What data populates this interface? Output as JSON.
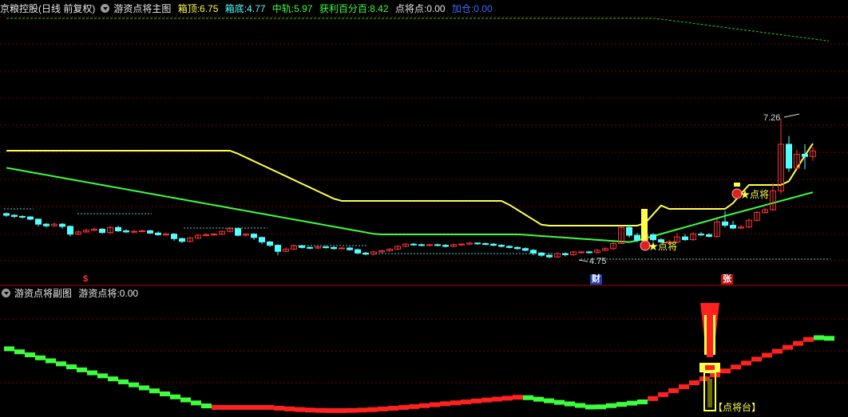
{
  "main_header": {
    "stock": "京粮控股(日线 前复权)",
    "indicator": "游资点将主图",
    "box_top_label": "箱顶:",
    "box_top_value": "6.75",
    "box_bottom_label": "箱底:",
    "box_bottom_value": "4.77",
    "mid_label": "中轨:",
    "mid_value": "5.97",
    "profit_label": "获利百分百:",
    "profit_value": "8.42",
    "point_label": "点将点:",
    "point_value": "0.00",
    "add_label": "加仓:",
    "add_value": "0.00"
  },
  "sub_header": {
    "indicator": "游资点将副图",
    "label": "游资点将:",
    "value": "0.00"
  },
  "markers": {
    "s": "$",
    "cai": "财",
    "zhang": "张"
  },
  "colors": {
    "up": "#ff3232",
    "down": "#54ffff",
    "yellow": "#ffff4a",
    "green": "#22cc22",
    "bright_green": "#3cff3c",
    "red": "#ff2020",
    "grid": "#7a0000",
    "white": "#dddddd",
    "blue": "#3c6cff"
  },
  "chart_data": {
    "type": "candlestick",
    "high_annotation": "7.26",
    "low_annotation": "4.75",
    "point_label_1": "★点将",
    "point_label_2": "★点将",
    "sub_label": "【点将台】",
    "candles": [
      [
        5.55,
        5.52,
        5.57,
        5.49
      ],
      [
        5.52,
        5.5,
        5.54,
        5.47
      ],
      [
        5.5,
        5.49,
        5.52,
        5.46
      ],
      [
        5.49,
        5.45,
        5.51,
        5.43
      ],
      [
        5.45,
        5.36,
        5.46,
        5.32
      ],
      [
        5.36,
        5.33,
        5.38,
        5.3
      ],
      [
        5.33,
        5.36,
        5.39,
        5.31
      ],
      [
        5.36,
        5.32,
        5.38,
        5.28
      ],
      [
        5.32,
        5.18,
        5.34,
        5.14
      ],
      [
        5.18,
        5.22,
        5.25,
        5.16
      ],
      [
        5.22,
        5.25,
        5.28,
        5.2
      ],
      [
        5.25,
        5.27,
        5.3,
        5.23
      ],
      [
        5.27,
        5.21,
        5.29,
        5.19
      ],
      [
        5.21,
        5.3,
        5.33,
        5.18
      ],
      [
        5.3,
        5.24,
        5.33,
        5.22
      ],
      [
        5.24,
        5.22,
        5.27,
        5.2
      ],
      [
        5.22,
        5.23,
        5.26,
        5.2
      ],
      [
        5.23,
        5.24,
        5.26,
        5.21
      ],
      [
        5.24,
        5.2,
        5.26,
        5.18
      ],
      [
        5.2,
        5.17,
        5.23,
        5.15
      ],
      [
        5.17,
        5.18,
        5.21,
        5.15
      ],
      [
        5.18,
        5.1,
        5.2,
        5.06
      ],
      [
        5.1,
        5.05,
        5.12,
        5.02
      ],
      [
        5.05,
        5.11,
        5.13,
        5.03
      ],
      [
        5.11,
        5.16,
        5.18,
        5.09
      ],
      [
        5.16,
        5.17,
        5.2,
        5.14
      ],
      [
        5.17,
        5.18,
        5.2,
        5.15
      ],
      [
        5.18,
        5.23,
        5.25,
        5.16
      ],
      [
        5.23,
        5.28,
        5.31,
        5.21
      ],
      [
        5.28,
        5.16,
        5.3,
        5.14
      ],
      [
        5.16,
        5.18,
        5.2,
        5.14
      ],
      [
        5.18,
        5.12,
        5.2,
        5.08
      ],
      [
        5.12,
        5.04,
        5.14,
        5.0
      ],
      [
        5.04,
        4.98,
        5.06,
        4.95
      ],
      [
        4.98,
        4.87,
        5.0,
        4.8
      ],
      [
        4.87,
        4.91,
        4.94,
        4.85
      ],
      [
        4.91,
        4.97,
        4.99,
        4.89
      ],
      [
        4.97,
        4.94,
        4.99,
        4.92
      ],
      [
        4.94,
        4.93,
        4.96,
        4.91
      ],
      [
        4.93,
        4.95,
        4.97,
        4.91
      ],
      [
        4.95,
        4.94,
        4.97,
        4.92
      ],
      [
        4.94,
        4.92,
        4.96,
        4.9
      ],
      [
        4.92,
        4.93,
        4.95,
        4.91
      ],
      [
        4.93,
        4.9,
        4.95,
        4.88
      ],
      [
        4.9,
        4.84,
        4.92,
        4.82
      ],
      [
        4.84,
        4.82,
        4.86,
        4.8
      ],
      [
        4.82,
        4.86,
        4.88,
        4.8
      ],
      [
        4.86,
        4.88,
        4.9,
        4.84
      ],
      [
        4.88,
        4.91,
        4.93,
        4.86
      ],
      [
        4.91,
        4.96,
        4.98,
        4.89
      ],
      [
        4.96,
        5.0,
        5.02,
        4.94
      ],
      [
        5.0,
        4.99,
        5.02,
        4.97
      ],
      [
        4.99,
        4.98,
        5.01,
        4.96
      ],
      [
        4.98,
        4.99,
        5.01,
        4.96
      ],
      [
        4.99,
        4.98,
        5.01,
        4.96
      ],
      [
        4.98,
        4.96,
        5.0,
        4.94
      ],
      [
        4.96,
        4.99,
        5.01,
        4.94
      ],
      [
        4.99,
        5.0,
        5.02,
        4.97
      ],
      [
        5.0,
        5.02,
        5.04,
        4.98
      ],
      [
        5.02,
        5.01,
        5.03,
        4.99
      ],
      [
        5.01,
        5.0,
        5.03,
        4.98
      ],
      [
        5.0,
        4.98,
        5.02,
        4.96
      ],
      [
        4.98,
        4.96,
        5.0,
        4.94
      ],
      [
        4.96,
        4.94,
        4.98,
        4.92
      ],
      [
        4.94,
        4.92,
        4.96,
        4.9
      ],
      [
        4.92,
        4.89,
        4.94,
        4.87
      ],
      [
        4.89,
        4.84,
        4.91,
        4.8
      ],
      [
        4.84,
        4.8,
        4.86,
        4.77
      ],
      [
        4.8,
        4.77,
        4.82,
        4.75
      ],
      [
        4.77,
        4.83,
        4.85,
        4.75
      ],
      [
        4.83,
        4.81,
        4.85,
        4.78
      ],
      [
        4.81,
        4.86,
        4.88,
        4.79
      ],
      [
        4.86,
        4.86,
        4.88,
        4.83
      ],
      [
        4.86,
        4.85,
        4.88,
        4.83
      ],
      [
        4.85,
        4.89,
        4.91,
        4.83
      ],
      [
        4.89,
        4.92,
        4.95,
        4.87
      ],
      [
        4.92,
        5.01,
        5.04,
        4.9
      ],
      [
        5.01,
        5.3,
        5.32,
        5.0
      ],
      [
        5.3,
        5.16,
        5.35,
        5.12
      ],
      [
        5.16,
        5.07,
        5.2,
        5.04
      ],
      [
        5.07,
        5.17,
        5.22,
        5.05
      ],
      [
        5.17,
        5.08,
        5.2,
        5.05
      ],
      [
        5.08,
        5.04,
        5.11,
        5.01
      ],
      [
        5.04,
        5.04,
        5.08,
        5.02
      ],
      [
        5.04,
        5.13,
        5.2,
        5.02
      ],
      [
        5.13,
        5.08,
        5.18,
        5.06
      ],
      [
        5.08,
        5.18,
        5.22,
        5.06
      ],
      [
        5.18,
        5.17,
        5.22,
        5.15
      ],
      [
        5.17,
        5.14,
        5.2,
        5.12
      ],
      [
        5.14,
        5.4,
        5.45,
        5.12
      ],
      [
        5.4,
        5.34,
        5.6,
        5.3
      ],
      [
        5.34,
        5.29,
        5.42,
        5.27
      ],
      [
        5.29,
        5.31,
        5.35,
        5.27
      ],
      [
        5.31,
        5.43,
        5.46,
        5.29
      ],
      [
        5.43,
        5.57,
        5.6,
        5.41
      ],
      [
        5.57,
        5.62,
        5.66,
        5.55
      ],
      [
        5.62,
        5.96,
        6.1,
        5.6
      ],
      [
        5.96,
        6.8,
        7.26,
        5.9
      ],
      [
        6.8,
        6.37,
        6.95,
        6.3
      ],
      [
        6.37,
        6.62,
        6.7,
        6.35
      ],
      [
        6.62,
        6.58,
        6.8,
        6.35
      ],
      [
        6.58,
        6.68,
        6.75,
        6.5
      ]
    ]
  }
}
